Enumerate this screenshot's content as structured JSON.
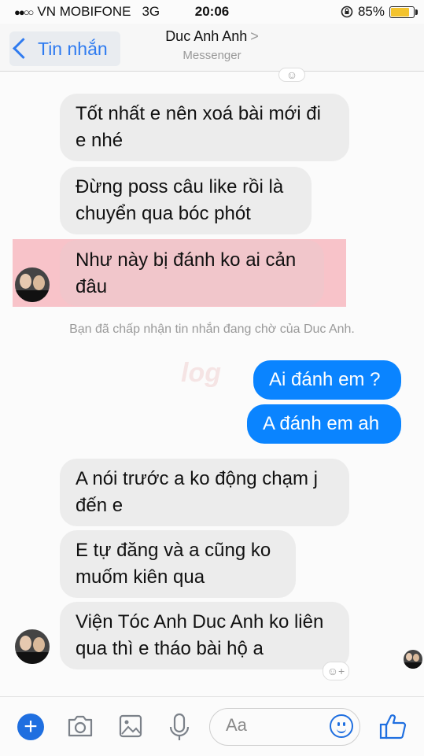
{
  "status": {
    "carrier": "VN MOBIFONE",
    "network": "3G",
    "time": "20:06",
    "battery_percent": "85%",
    "battery_level": 0.85,
    "battery_color": "#f3c32e"
  },
  "header": {
    "back_label": "Tin nhắn",
    "title": "Duc Anh Anh",
    "title_chevron": ">",
    "subtitle": "Messenger"
  },
  "messages": [
    {
      "from": "them",
      "text": "Tốt nhất e nên xoá bài mới đi e nhé"
    },
    {
      "from": "them",
      "text": "Đừng poss câu like rồi là chuyển qua bóc phót"
    },
    {
      "from": "them",
      "text": "Như này bị đánh ko ai cản đâu",
      "highlighted": true
    },
    {
      "from": "me",
      "text": "Ai đánh em ?"
    },
    {
      "from": "me",
      "text": "A đánh em ah"
    },
    {
      "from": "them",
      "text": "A nói trước a ko động chạm j đến e"
    },
    {
      "from": "them",
      "text": "E tự đăng và a cũng ko muốm kiên qua"
    },
    {
      "from": "them",
      "text": "Viện Tóc Anh Duc Anh ko liên qua thì e tháo bài hộ a"
    }
  ],
  "system_note": "Bạn đã chấp nhận tin nhắn đang chờ của Duc Anh.",
  "composer": {
    "placeholder": "Aa"
  },
  "icons": [
    "add-icon",
    "camera-icon",
    "image-icon",
    "microphone-icon",
    "emoji-icon",
    "thumbs-up-icon",
    "react-icon"
  ],
  "colors": {
    "accent": "#0a84ff",
    "incoming_bubble": "#ececec",
    "highlight": "#f596a0"
  }
}
